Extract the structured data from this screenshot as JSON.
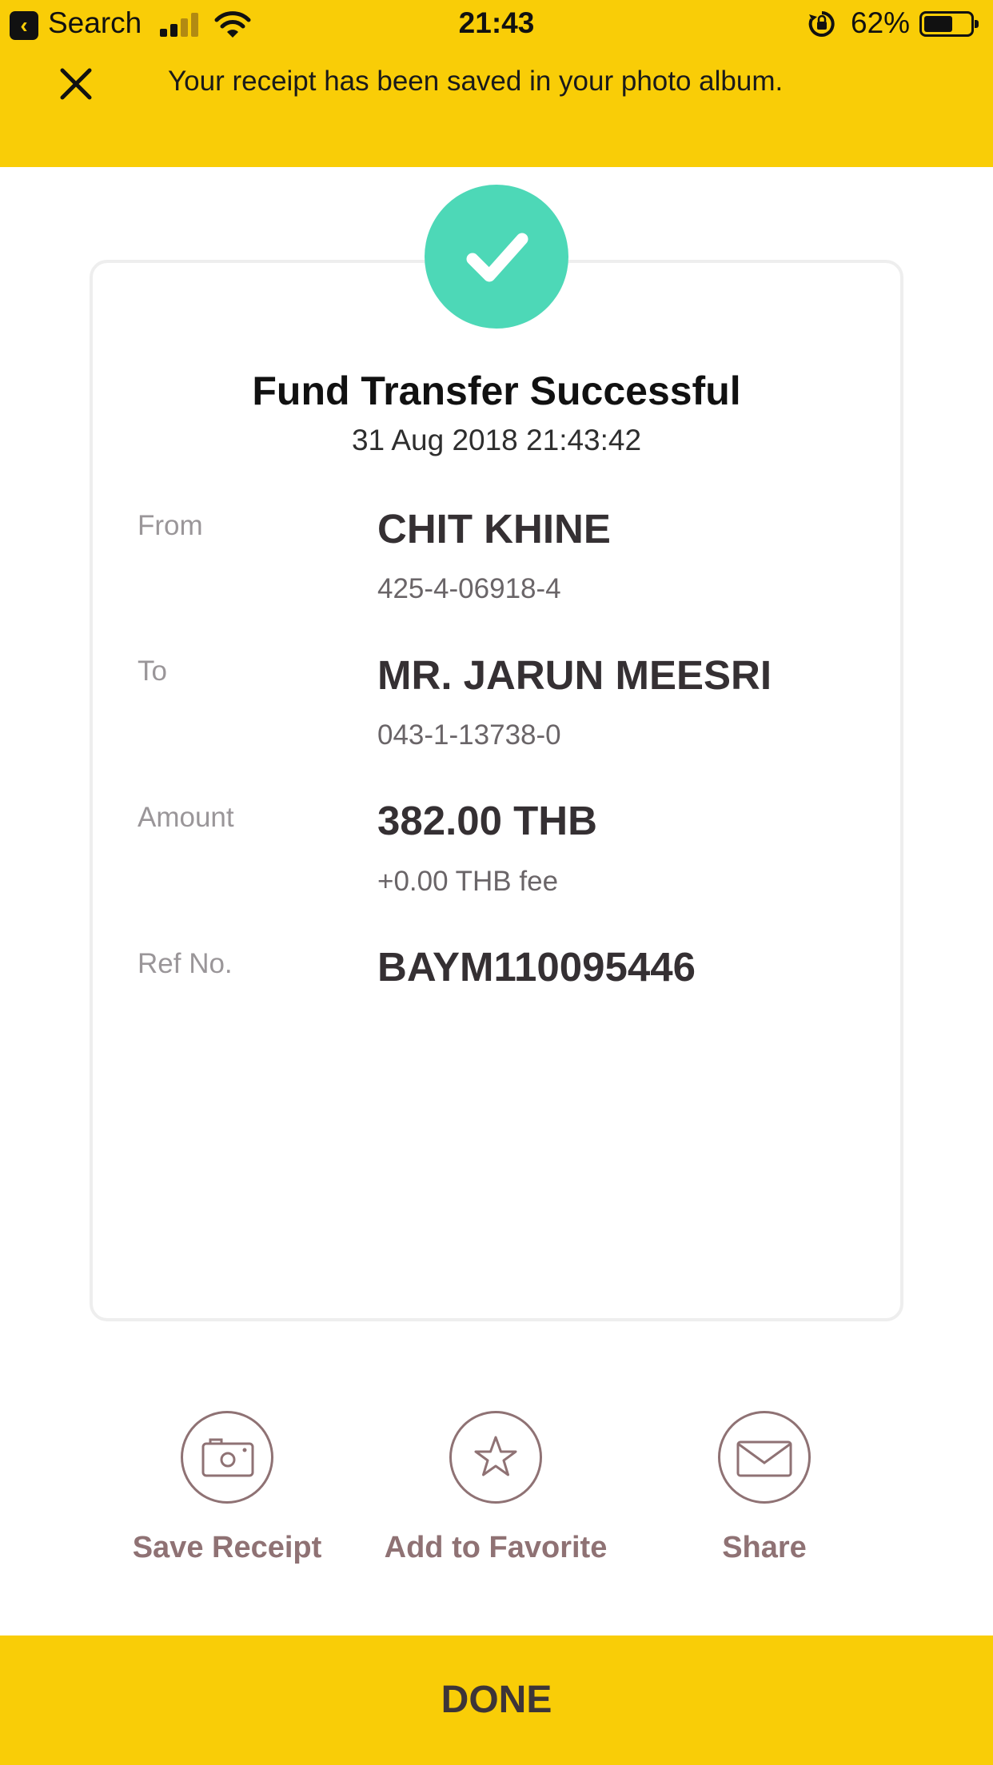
{
  "status_bar": {
    "back_label": "Search",
    "time": "21:43",
    "battery": "62%",
    "battery_level": 0.62
  },
  "banner": {
    "message": "Your receipt has been saved in your photo album.",
    "close_icon": "close-icon",
    "color": "#f9cd07"
  },
  "receipt": {
    "status_icon": "check-icon",
    "status_color": "#4dd8b7",
    "title": "Fund Transfer Successful",
    "datetime": "31 Aug 2018 21:43:42",
    "from": {
      "label": "From",
      "name": "CHIT KHINE",
      "account": "425-4-06918-4"
    },
    "to": {
      "label": "To",
      "name": "MR. JARUN MEESRI",
      "account": "043-1-13738-0"
    },
    "amount": {
      "label": "Amount",
      "value": "382.00 THB",
      "fee": "+0.00 THB fee"
    },
    "ref": {
      "label": "Ref No.",
      "value": "BAYM110095446"
    }
  },
  "actions": [
    {
      "label": "Save Receipt",
      "icon": "camera-icon"
    },
    {
      "label": "Add to Favorite",
      "icon": "star-icon"
    },
    {
      "label": "Share",
      "icon": "envelope-icon"
    }
  ],
  "done_label": "DONE"
}
